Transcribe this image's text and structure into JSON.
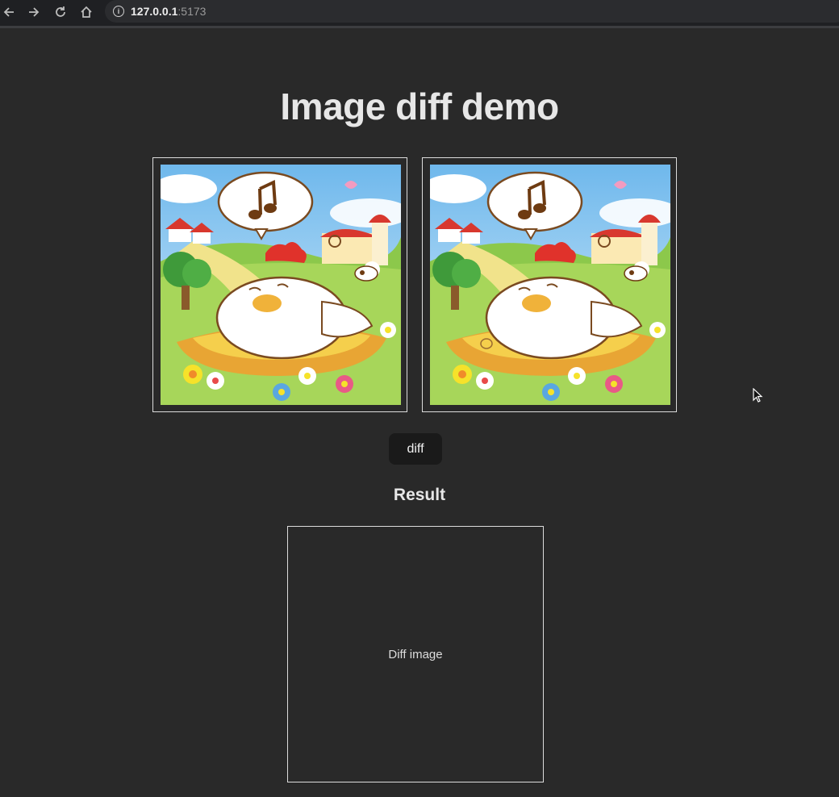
{
  "browser": {
    "url_host": "127.0.0.1",
    "url_port": ":5173",
    "icons": [
      "back-arrow-icon",
      "forward-arrow-icon",
      "reload-icon",
      "home-icon",
      "info-icon"
    ]
  },
  "page": {
    "title": "Image diff demo",
    "images": [
      {
        "alt": "original-cartoon-hen"
      },
      {
        "alt": "modified-cartoon-hen"
      }
    ],
    "diff_button_label": "diff",
    "result_heading": "Result",
    "result_placeholder": "Diff image"
  },
  "colors": {
    "background": "#292929",
    "button": "#1a1a1a",
    "frame_border": "#dcdcdc"
  }
}
